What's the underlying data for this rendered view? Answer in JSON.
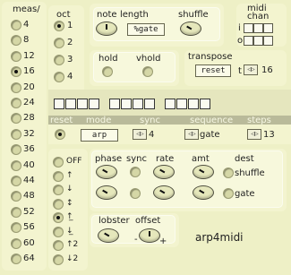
{
  "meas": {
    "title": "meas/",
    "options": [
      "4",
      "8",
      "12",
      "16",
      "20",
      "24",
      "28",
      "32",
      "36",
      "40",
      "44",
      "48",
      "52",
      "56",
      "60",
      "64"
    ],
    "selected": "16"
  },
  "oct": {
    "title": "oct",
    "options": [
      "1",
      "2",
      "3",
      "4"
    ],
    "selected": "1"
  },
  "note": {
    "label": "note",
    "length_label": "length",
    "length_value": "%gate",
    "shuffle_label": "shuffle"
  },
  "midi": {
    "label": "midi",
    "chan_label": "chan",
    "in_prefix": "i",
    "out_prefix": "o",
    "transpose_prefix": "t",
    "transpose_value": "16"
  },
  "hold": {
    "hold_label": "hold",
    "vhold_label": "vhold"
  },
  "transpose": {
    "label": "transpose",
    "reset_label": "reset"
  },
  "control": {
    "reset": "reset",
    "mode": "mode",
    "mode_value": "arp",
    "sync": "sync",
    "sync_value": "4",
    "sequence": "sequence",
    "sequence_value": "gate",
    "steps": "steps",
    "steps_value": "13"
  },
  "direction": {
    "options": [
      "OFF",
      "↑",
      "↓",
      "↕",
      "↑̲",
      "↓̲",
      "↑2",
      "↓2"
    ],
    "selected": 4
  },
  "lfo": {
    "phase": "phase",
    "sync": "sync",
    "rate": "rate",
    "amt": "amt",
    "dest": "dest",
    "dest_options": [
      "shuffle",
      "gate"
    ]
  },
  "lobster": {
    "lobster": "lobster",
    "offset": "offset",
    "minus": "-",
    "plus": "+"
  },
  "brand": {
    "name": "arp4midi"
  },
  "colors": {
    "bg": "#eef0c6",
    "panel": "#f3f4cf",
    "accent": "#1a1a1a"
  }
}
